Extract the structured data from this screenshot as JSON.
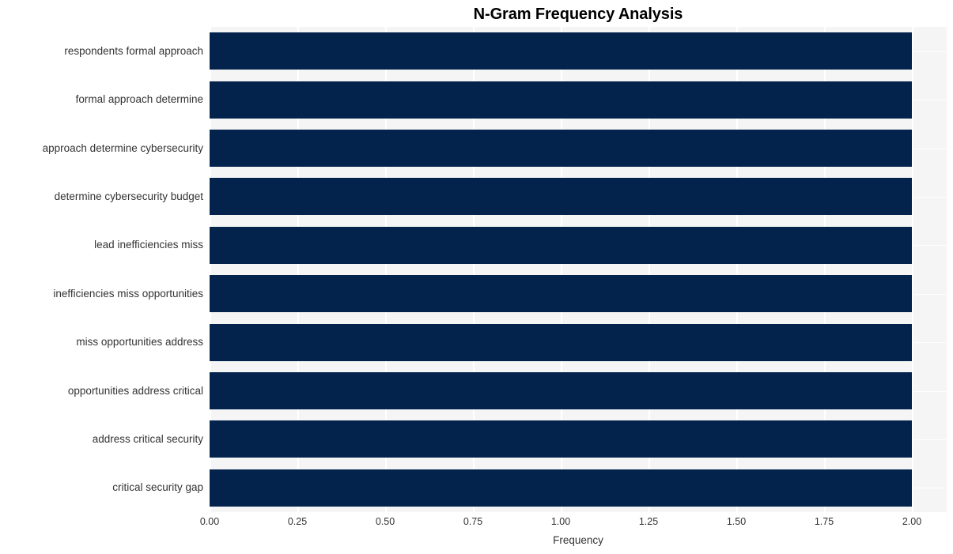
{
  "chart_data": {
    "type": "bar",
    "orientation": "horizontal",
    "title": "N-Gram Frequency Analysis",
    "xlabel": "Frequency",
    "ylabel": "",
    "categories": [
      "respondents formal approach",
      "formal approach determine",
      "approach determine cybersecurity",
      "determine cybersecurity budget",
      "lead inefficiencies miss",
      "inefficiencies miss opportunities",
      "miss opportunities address",
      "opportunities address critical",
      "address critical security",
      "critical security gap"
    ],
    "values": [
      2,
      2,
      2,
      2,
      2,
      2,
      2,
      2,
      2,
      2
    ],
    "xlim": [
      0.0,
      2.0
    ],
    "xticks": [
      0.0,
      0.25,
      0.5,
      0.75,
      1.0,
      1.25,
      1.5,
      1.75,
      2.0
    ],
    "xtick_labels": [
      "0.00",
      "0.25",
      "0.50",
      "0.75",
      "1.00",
      "1.25",
      "1.50",
      "1.75",
      "2.00"
    ],
    "grid": true,
    "legend": null,
    "bar_color": "#04234c",
    "plot_background": "#f5f5f5",
    "figure_background": "#ffffff",
    "gridline_color": "#ffffff",
    "text_color": "#333333",
    "title_color": "#000000"
  }
}
